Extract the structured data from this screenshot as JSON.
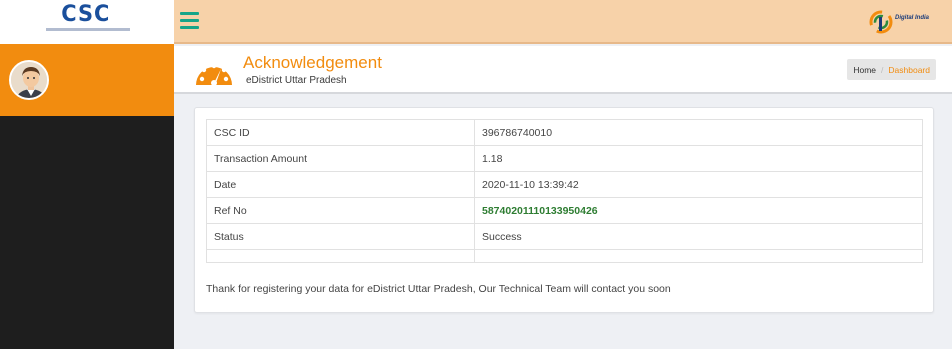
{
  "header": {
    "logo_text": "CSC",
    "logo_tagline": "E-GOVERNANCE SERVICES INDIA LIMITED",
    "right_logo_text": "Digital India"
  },
  "page": {
    "title": "Acknowledgement",
    "subtitle": "eDistrict Uttar Pradesh"
  },
  "breadcrumb": {
    "home": "Home",
    "separator": "/",
    "current": "Dashboard"
  },
  "details": [
    {
      "label": "CSC ID",
      "value": "396786740010"
    },
    {
      "label": "Transaction Amount",
      "value": "1.18"
    },
    {
      "label": "Date",
      "value": "2020-11-10 13:39:42"
    },
    {
      "label": "Ref No",
      "value": "58740201110133950426"
    },
    {
      "label": "Status",
      "value": "Success"
    }
  ],
  "message": "Thank for registering your data for eDistrict Uttar Pradesh, Our Technical Team will contact you soon",
  "colors": {
    "accent": "#f28c0f",
    "topbar": "#f7d2a9",
    "sidebar": "#1e1e1e",
    "ref_no": "#2e7d32"
  },
  "icons": [
    "menu-icon",
    "dashboard-gauge-icon",
    "user-avatar-icon",
    "csc-logo",
    "digital-india-logo"
  ]
}
